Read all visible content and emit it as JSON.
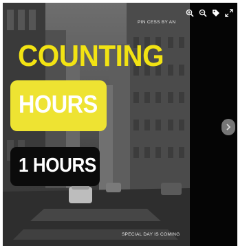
{
  "credit": "PIN CESS BY AN",
  "heading": "COUNTING",
  "hours_label": "HOURS",
  "countdown": "1 HOURS",
  "footer": "SPECIAL DAY IS COMING",
  "toolbar": {
    "icons": [
      "zoom-in-icon",
      "zoom-out-icon",
      "tag-icon",
      "expand-icon"
    ]
  },
  "nav": {
    "next_icon": "chevron-right-icon"
  },
  "colors": {
    "accent_yellow": "#f2e313",
    "box_yellow": "#eee332",
    "box_black": "#0b0b0b"
  }
}
